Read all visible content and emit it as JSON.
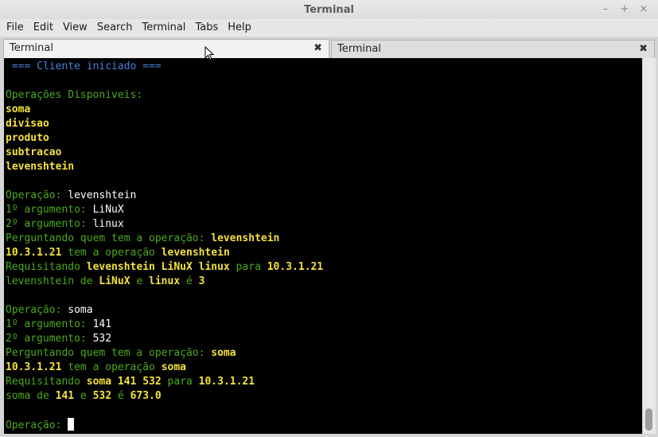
{
  "window": {
    "title": "Terminal",
    "controls": [
      "–",
      "+",
      "×"
    ]
  },
  "menu": [
    "File",
    "Edit",
    "View",
    "Search",
    "Terminal",
    "Tabs",
    "Help"
  ],
  "tabs": [
    {
      "label": "Terminal",
      "active": true
    },
    {
      "label": "Terminal",
      "active": false
    }
  ],
  "tab_close_glyph": "✖",
  "colors": {
    "blue": "#4a7fd8",
    "green": "#4caa1c",
    "yellow": "#f3e23a",
    "white": "#ffffff"
  },
  "terminal": {
    "lines": [
      [
        [
          "blue",
          " === Cliente iniciado ==="
        ]
      ],
      [],
      [
        [
          "green",
          "Operações Disponiveis:"
        ]
      ],
      [
        [
          "yellow",
          "soma"
        ]
      ],
      [
        [
          "yellow",
          "divisao"
        ]
      ],
      [
        [
          "yellow",
          "produto"
        ]
      ],
      [
        [
          "yellow",
          "subtracao"
        ]
      ],
      [
        [
          "yellow",
          "levenshtein"
        ]
      ],
      [],
      [
        [
          "green",
          "Operação: "
        ],
        [
          "white",
          "levenshtein"
        ]
      ],
      [
        [
          "green",
          "1º argumento: "
        ],
        [
          "white",
          "LiNuX"
        ]
      ],
      [
        [
          "green",
          "2º argumento: "
        ],
        [
          "white",
          "linux"
        ]
      ],
      [
        [
          "green",
          "Perguntando quem tem a operação: "
        ],
        [
          "yellow",
          "levenshtein"
        ]
      ],
      [
        [
          "yellow",
          "10.3.1.21"
        ],
        [
          "green",
          " tem a operação "
        ],
        [
          "yellow",
          "levenshtein"
        ]
      ],
      [
        [
          "green",
          "Requisitando "
        ],
        [
          "yellow",
          "levenshtein LiNuX linux"
        ],
        [
          "green",
          " para "
        ],
        [
          "yellow",
          "10.3.1.21"
        ]
      ],
      [
        [
          "green",
          "levenshtein de "
        ],
        [
          "yellow",
          "LiNuX"
        ],
        [
          "green",
          " e "
        ],
        [
          "yellow",
          "linux"
        ],
        [
          "green",
          " é "
        ],
        [
          "yellow",
          "3"
        ]
      ],
      [],
      [
        [
          "green",
          "Operação: "
        ],
        [
          "white",
          "soma"
        ]
      ],
      [
        [
          "green",
          "1º argumento: "
        ],
        [
          "white",
          "141"
        ]
      ],
      [
        [
          "green",
          "2º argumento: "
        ],
        [
          "white",
          "532"
        ]
      ],
      [
        [
          "green",
          "Perguntando quem tem a operação: "
        ],
        [
          "yellow",
          "soma"
        ]
      ],
      [
        [
          "yellow",
          "10.3.1.21"
        ],
        [
          "green",
          " tem a operação "
        ],
        [
          "yellow",
          "soma"
        ]
      ],
      [
        [
          "green",
          "Requisitando "
        ],
        [
          "yellow",
          "soma 141 532"
        ],
        [
          "green",
          " para "
        ],
        [
          "yellow",
          "10.3.1.21"
        ]
      ],
      [
        [
          "green",
          "soma de "
        ],
        [
          "yellow",
          "141"
        ],
        [
          "green",
          " e "
        ],
        [
          "yellow",
          "532"
        ],
        [
          "green",
          " é "
        ],
        [
          "yellow",
          "673.0"
        ]
      ],
      [],
      [
        [
          "green",
          "Operação: "
        ]
      ]
    ]
  }
}
